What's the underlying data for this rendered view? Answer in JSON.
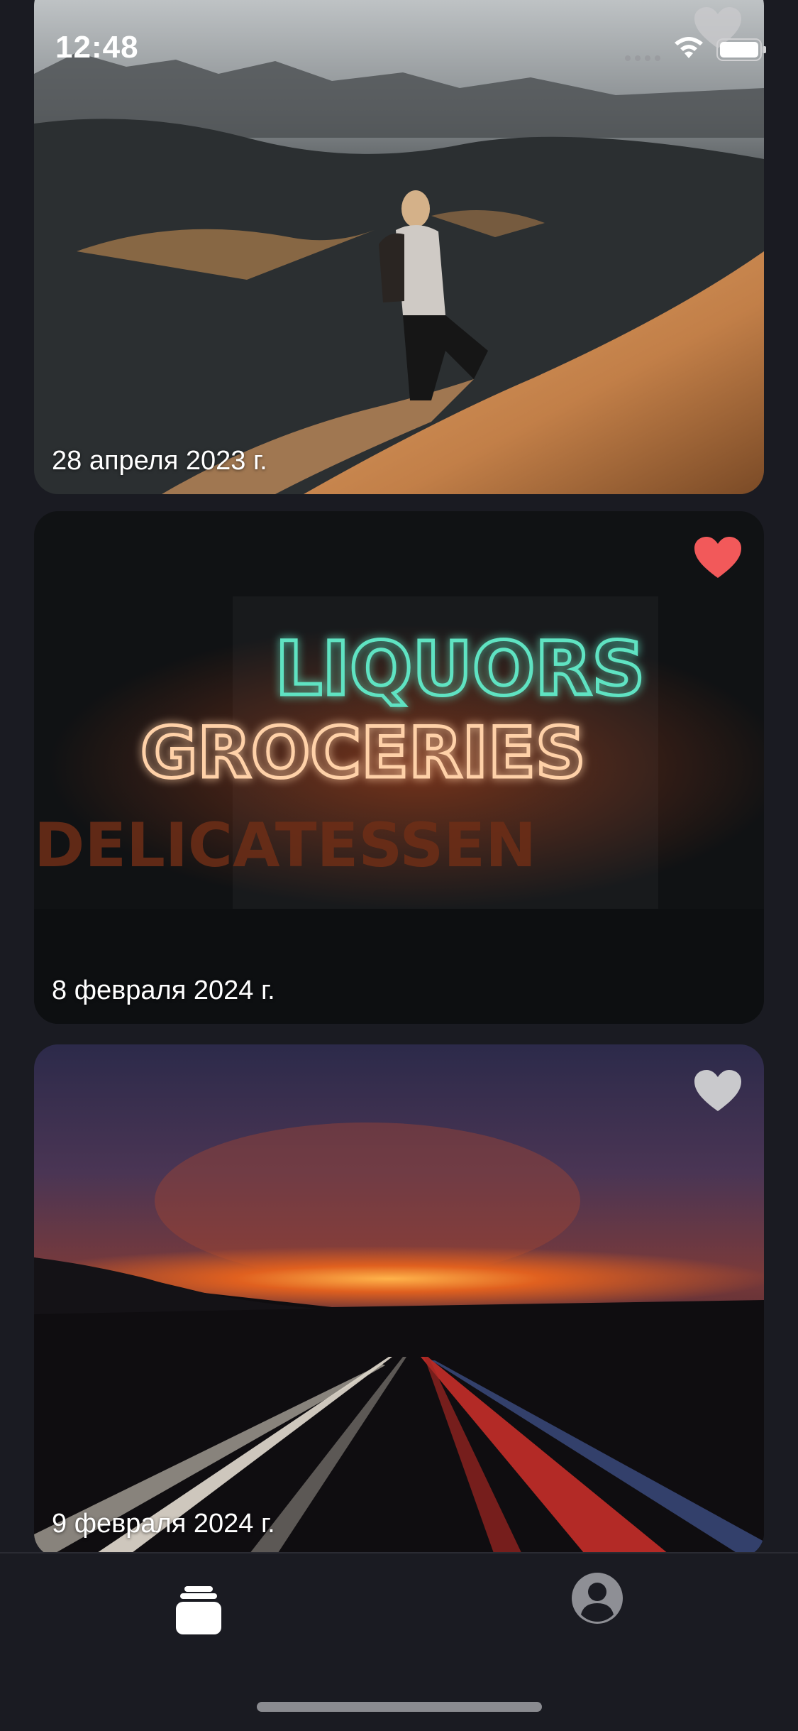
{
  "status_bar": {
    "time": "12:48"
  },
  "feed": {
    "cards": [
      {
        "date": "28 апреля 2023 г.",
        "liked": false,
        "photo_icon": "desert-hiker-photo"
      },
      {
        "date": "8 февраля 2024 г.",
        "liked": true,
        "photo_icon": "neon-sign-photo",
        "sign_lines": [
          "LIQUORS",
          "GROCERIES",
          "DELICATESSEN"
        ]
      },
      {
        "date": "9 февраля 2024 г.",
        "liked": false,
        "photo_icon": "highway-sunset-photo"
      }
    ]
  },
  "tab_bar": {
    "items": [
      {
        "icon": "stack-icon",
        "selected": true
      },
      {
        "icon": "person-icon",
        "selected": false
      }
    ]
  },
  "colors": {
    "background": "#1a1b22",
    "like_active": "#f2595a",
    "like_inactive": "#c9c9cc",
    "tab_active": "#ffffff",
    "tab_inactive": "#8e8f95"
  }
}
